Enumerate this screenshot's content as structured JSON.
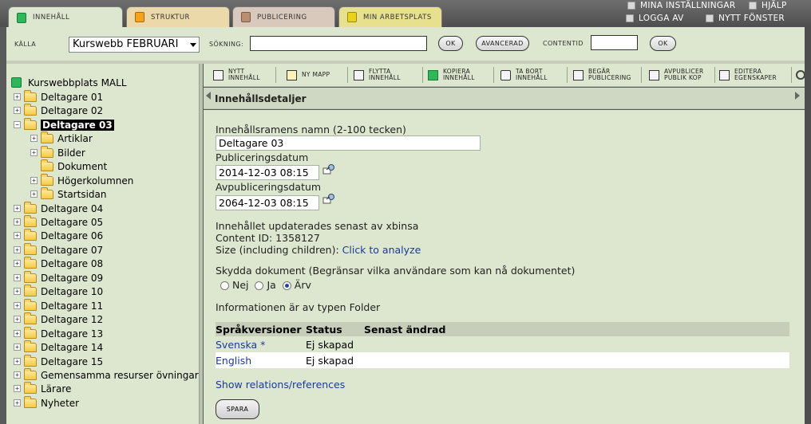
{
  "tabs": [
    {
      "label": "Innehåll"
    },
    {
      "label": "Struktur"
    },
    {
      "label": "Publicering"
    },
    {
      "label": "Min arbetsplats"
    }
  ],
  "top_links": {
    "settings": "Mina inställningar",
    "help": "Hjälp",
    "logout": "Logga av",
    "new_window": "Nytt fönster"
  },
  "search": {
    "source_label": "Källa",
    "source_value": "Kurswebb FEBRUARI",
    "search_label": "Sökning:",
    "search_value": "",
    "ok": "OK",
    "advanced": "Avancerad",
    "contentid_label": "ContentID",
    "contentid_value": "",
    "ok2": "OK"
  },
  "tree": {
    "root": "Kurswebbplats MALL",
    "items": [
      {
        "label": "Deltagare 01"
      },
      {
        "label": "Deltagare 02"
      },
      {
        "label": "Deltagare 03"
      },
      {
        "label": "Artiklar"
      },
      {
        "label": "Bilder"
      },
      {
        "label": "Dokument"
      },
      {
        "label": "Högerkolumnen"
      },
      {
        "label": "Startsidan"
      },
      {
        "label": "Deltagare 04"
      },
      {
        "label": "Deltagare 05"
      },
      {
        "label": "Deltagare 06"
      },
      {
        "label": "Deltagare 07"
      },
      {
        "label": "Deltagare 08"
      },
      {
        "label": "Deltagare 09"
      },
      {
        "label": "Deltagare 10"
      },
      {
        "label": "Deltagare 11"
      },
      {
        "label": "Deltagare 12"
      },
      {
        "label": "Deltagare 13"
      },
      {
        "label": "Deltagare 14"
      },
      {
        "label": "Deltagare 15"
      },
      {
        "label": "Gemensamma resurser övningar"
      },
      {
        "label": "Lärare"
      },
      {
        "label": "Nyheter"
      }
    ]
  },
  "toolbar": {
    "new_content": "Nytt innehåll",
    "new_folder": "Ny mapp",
    "move_content": "Flytta innehåll",
    "copy_content": "Kopiera innehåll",
    "delete_content": "Ta bort innehåll",
    "request_publish": "Begär publicering",
    "unpublish_copy": "Avpublicer publik kop",
    "edit_properties": "Editera egenskaper"
  },
  "panel": {
    "title": "Innehållsdetaljer",
    "name_label": "Innehållsramens namn (2-100 tecken)",
    "name_value": "Deltagare 03",
    "pubdate_label": "Publiceringsdatum",
    "pubdate_value": "2014-12-03 08:15",
    "unpubdate_label": "Avpubliceringsdatum",
    "unpubdate_value": "2064-12-03 08:15",
    "updated_by": "Innehållet updaterades senast av xbinsa",
    "content_id": "Content ID: 1358127",
    "size_label": "Size (including children):",
    "size_link": "Click to analyze",
    "protect_label": "Skydda dokument (Begränsar vilka användare som kan nå dokumentet)",
    "radio_no": "Nej",
    "radio_yes": "Ja",
    "radio_inherit": "Ärv",
    "type_info": "Informationen är av typen Folder",
    "relations_link": "Show relations/references",
    "save": "Spara"
  },
  "lang_table": {
    "headers": [
      "Språkversioner",
      "Status",
      "Senast ändrad"
    ],
    "rows": [
      {
        "lang": "Svenska *",
        "status": "Ej skapad",
        "changed": ""
      },
      {
        "lang": "English",
        "status": "Ej skapad",
        "changed": ""
      }
    ]
  }
}
